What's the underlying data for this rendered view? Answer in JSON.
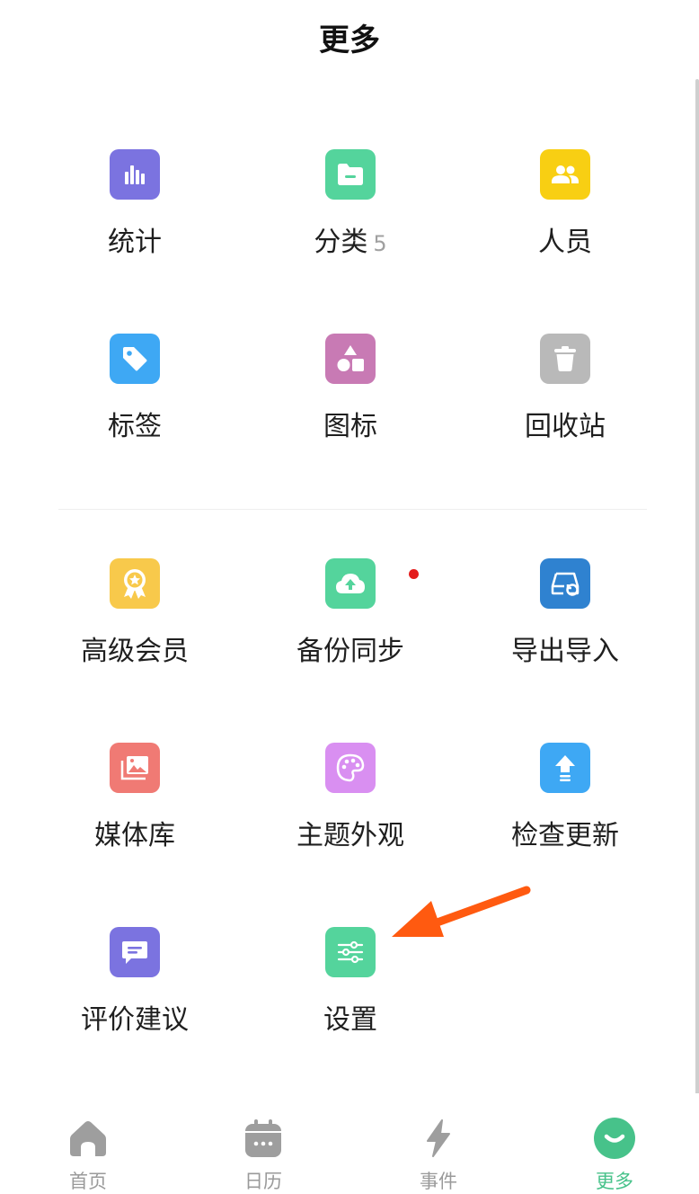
{
  "header": {
    "title": "更多"
  },
  "grid": [
    {
      "key": "stats",
      "label": "统计",
      "icon": "bar-chart-icon",
      "color": "#7b73e0"
    },
    {
      "key": "category",
      "label": "分类",
      "count": "5",
      "icon": "folder-icon",
      "color": "#54d49c"
    },
    {
      "key": "people",
      "label": "人员",
      "icon": "people-icon",
      "color": "#f8cf13"
    },
    {
      "key": "tags",
      "label": "标签",
      "icon": "tag-icon",
      "color": "#3ea8f4"
    },
    {
      "key": "icons",
      "label": "图标",
      "icon": "shapes-icon",
      "color": "#c87ab4"
    },
    {
      "key": "trash",
      "label": "回收站",
      "icon": "trash-icon",
      "color": "#b9b9b9"
    },
    {
      "key": "premium",
      "label": "高级会员",
      "icon": "award-icon",
      "color": "#f8c94b"
    },
    {
      "key": "backup",
      "label": "备份同步",
      "icon": "cloud-upload-icon",
      "color": "#54d49c"
    },
    {
      "key": "export",
      "label": "导出导入",
      "icon": "export-import-icon",
      "color": "#2f82d0"
    },
    {
      "key": "media",
      "label": "媒体库",
      "icon": "media-library-icon",
      "color": "#f07a74"
    },
    {
      "key": "theme",
      "label": "主题外观",
      "icon": "palette-icon",
      "color": "#d98ff1"
    },
    {
      "key": "update",
      "label": "检查更新",
      "icon": "update-arrow-icon",
      "color": "#3ea8f4"
    },
    {
      "key": "feedback",
      "label": "评价建议",
      "icon": "chat-icon",
      "color": "#7b73e0"
    },
    {
      "key": "settings",
      "label": "设置",
      "icon": "sliders-icon",
      "color": "#54d49c"
    }
  ],
  "annotation": {
    "arrow_color": "#ff5a10"
  },
  "tabs": [
    {
      "key": "home",
      "label": "首页",
      "icon": "home-icon",
      "active": false
    },
    {
      "key": "calendar",
      "label": "日历",
      "icon": "calendar-icon",
      "active": false
    },
    {
      "key": "events",
      "label": "事件",
      "icon": "lightning-icon",
      "active": false
    },
    {
      "key": "more",
      "label": "更多",
      "icon": "smile-icon",
      "active": true,
      "color": "#47c28a"
    }
  ]
}
